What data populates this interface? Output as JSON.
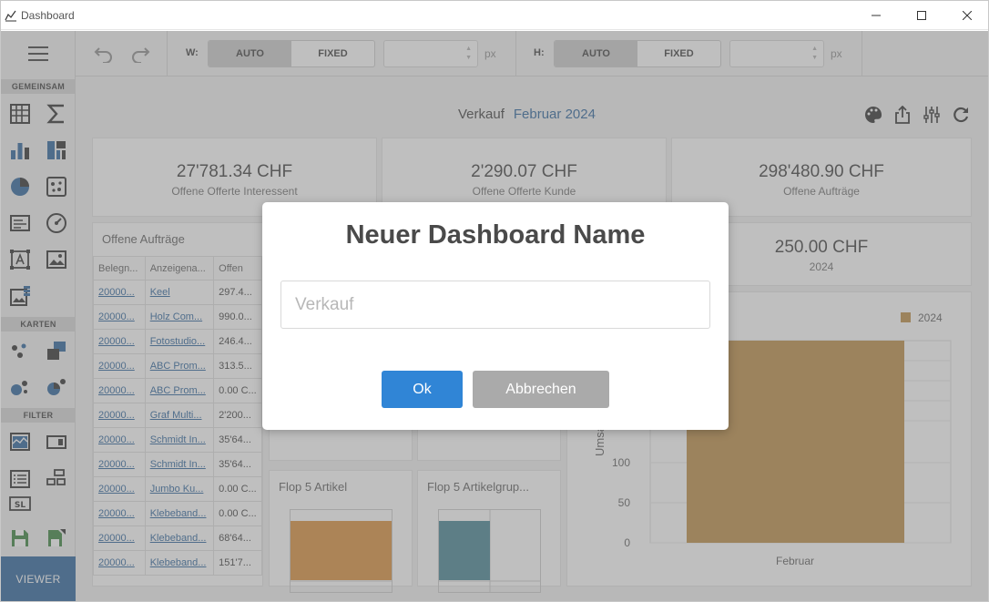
{
  "window": {
    "title": "Dashboard"
  },
  "sidebar": {
    "sections": [
      "GEMEINSAM",
      "KARTEN",
      "FILTER"
    ],
    "viewer_label": "VIEWER"
  },
  "toolbar": {
    "width_label": "W:",
    "height_label": "H:",
    "auto_label": "AUTO",
    "fixed_label": "FIXED",
    "unit": "px"
  },
  "dashboard": {
    "name": "Verkauf",
    "period": "Februar 2024"
  },
  "kpis": [
    {
      "value": "27'781.34 CHF",
      "label": "Offene Offerte Interessent"
    },
    {
      "value": "2'290.07 CHF",
      "label": "Offene Offerte Kunde"
    },
    {
      "value": "298'480.90 CHF",
      "label": "Offene Aufträge"
    },
    {
      "value": "250.00 CHF",
      "label": "2024"
    }
  ],
  "orders_table": {
    "title": "Offene Aufträge",
    "columns": [
      "Belegn...",
      "Anzeigena...",
      "Offen"
    ],
    "rows": [
      [
        "20000...",
        "Keel",
        "297.4..."
      ],
      [
        "20000...",
        "Holz Com...",
        "990.0..."
      ],
      [
        "20000...",
        "Fotostudio...",
        "246.4..."
      ],
      [
        "20000...",
        "ABC Prom...",
        "313.5..."
      ],
      [
        "20000...",
        "ABC Prom...",
        "0.00 C..."
      ],
      [
        "20000...",
        "Graf Multi...",
        "2'200..."
      ],
      [
        "20000...",
        "Schmidt In...",
        "35'64..."
      ],
      [
        "20000...",
        "Schmidt In...",
        "35'64..."
      ],
      [
        "20000...",
        "Jumbo Ku...",
        "0.00 C..."
      ],
      [
        "20000...",
        "Klebeband...",
        "0.00 C..."
      ],
      [
        "20000...",
        "Klebeband...",
        "68'64..."
      ],
      [
        "20000...",
        "Klebeband...",
        "151'7..."
      ]
    ]
  },
  "mini_charts": [
    {
      "title": "Flop 5 Artikel",
      "color": "#d9882f"
    },
    {
      "title": "Flop 5 Artikelgrup...",
      "color": "#3a7c8c"
    }
  ],
  "chart_data": {
    "type": "bar",
    "categories": [
      "Februar"
    ],
    "series": [
      {
        "name": "2024",
        "values": [
          250
        ],
        "color": "#b8863b"
      }
    ],
    "ylabel": "Umsa",
    "y_ticks": [
      0,
      50,
      100
    ],
    "legend": "top-right"
  },
  "modal": {
    "title": "Neuer Dashboard Name",
    "input_placeholder": "Verkauf",
    "input_value": "",
    "ok_label": "Ok",
    "cancel_label": "Abbrechen",
    "ok_color": "#3085d6",
    "cancel_color": "#aaaaaa"
  }
}
